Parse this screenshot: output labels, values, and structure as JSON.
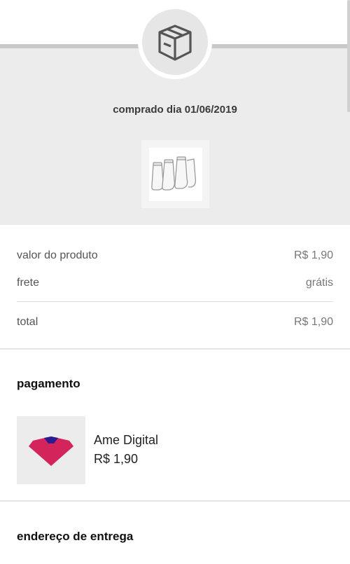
{
  "header": {
    "icon": "package-box-icon",
    "purchase_date": "comprado dia 01/06/2019",
    "product_image": "socks-product-image"
  },
  "summary": {
    "product_value_label": "valor do produto",
    "product_value": "R$ 1,90",
    "shipping_label": "frete",
    "shipping_value": "grátis",
    "total_label": "total",
    "total_value": "R$ 1,90"
  },
  "payment": {
    "title": "pagamento",
    "method_icon": "ame-digital-logo",
    "method_name": "Ame Digital",
    "amount": "R$ 1,90"
  },
  "delivery": {
    "title": "endereço de entrega"
  }
}
